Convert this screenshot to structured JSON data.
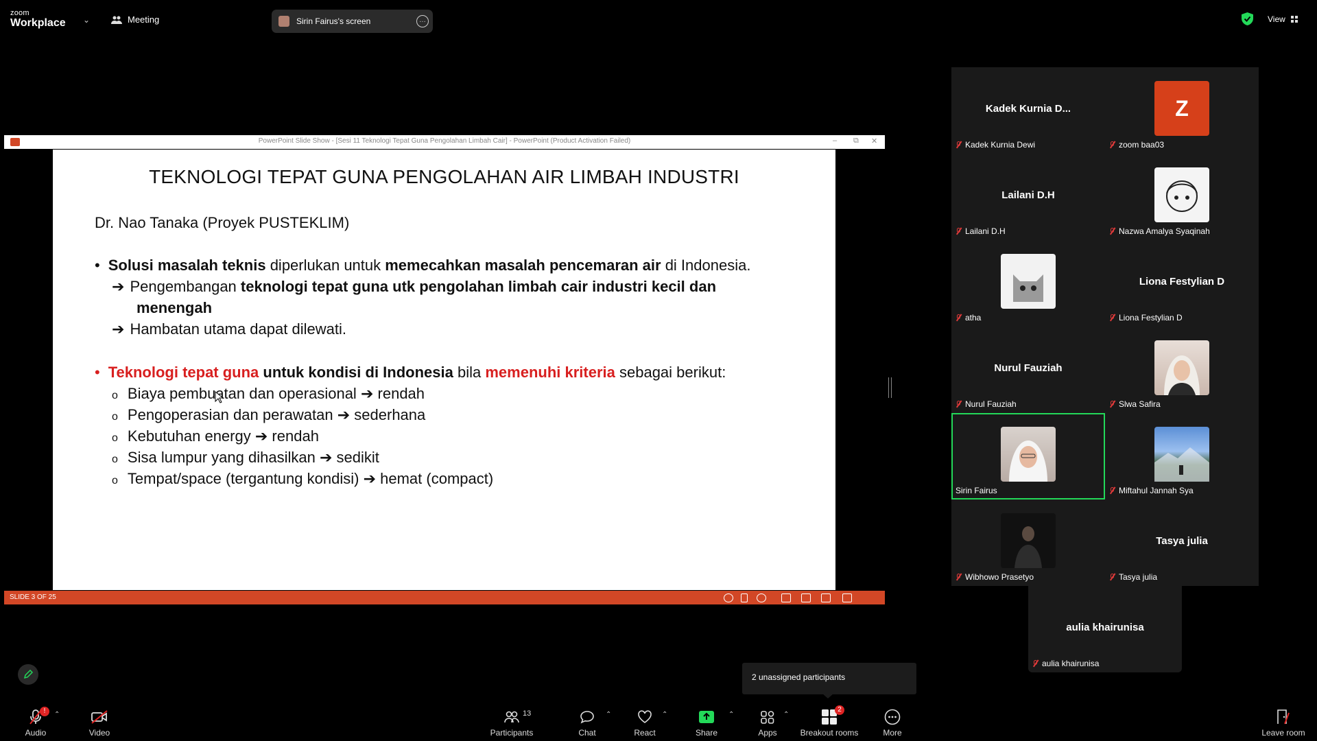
{
  "app": {
    "logo_top": "zoom",
    "logo_bottom": "Workplace",
    "meeting_label": "Meeting",
    "share_pill": "Sirin Fairus's screen",
    "view_label": "View"
  },
  "ppt": {
    "window_title": "PowerPoint Slide Show - [Sesi 11 Teknologi Tepat Guna Pengolahan Limbah Cair] - PowerPoint (Product Activation Failed)",
    "slide_title": "TEKNOLOGI TEPAT GUNA PENGOLAHAN AIR LIMBAH INDUSTRI",
    "author": "Dr. Nao Tanaka (Proyek PUSTEKLIM)",
    "b1": {
      "p1": "Solusi masalah teknis",
      "p2": " diperlukan untuk ",
      "p3": "memecahkan masalah pencemaran air",
      "p4": " di Indonesia."
    },
    "b1a": {
      "p1": "Pengembangan ",
      "p2": "teknologi tepat guna utk pengolahan limbah cair industri kecil dan",
      "p3": "menengah"
    },
    "b1b": "Hambatan utama dapat dilewati.",
    "b2": {
      "p1": "Teknologi tepat guna",
      "p2": " untuk kondisi di Indonesia",
      "p3": " bila ",
      "p4": "memenuhi kriteria",
      "p5": " sebagai berikut:"
    },
    "sub": [
      {
        "a": "Biaya pembuatan dan operasional",
        "b": "rendah"
      },
      {
        "a": "Pengoperasian dan perawatan",
        "b": "sederhana"
      },
      {
        "a": "Kebutuhan energy",
        "b": "rendah"
      },
      {
        "a": "Sisa lumpur yang dihasilkan",
        "b": "sedikit"
      },
      {
        "a": "Tempat/space (tergantung kondisi)",
        "b": "hemat (compact)"
      }
    ],
    "status": "SLIDE 3 OF 25"
  },
  "participants": [
    {
      "display": "Kadek Kurnia D...",
      "label": "Kadek Kurnia Dewi"
    },
    {
      "display": "Z",
      "label": "zoom baa03"
    },
    {
      "display": "Lailani D.H",
      "label": "Lailani D.H"
    },
    {
      "display": "",
      "label": "Nazwa Amalya Syaqinah"
    },
    {
      "display": "",
      "label": "atha"
    },
    {
      "display": "Liona Festylian D",
      "label": "Liona Festylian D"
    },
    {
      "display": "Nurul Fauziah",
      "label": "Nurul Fauziah"
    },
    {
      "display": "",
      "label": "Slwa Safira"
    },
    {
      "display": "",
      "label": "Sirin Fairus"
    },
    {
      "display": "",
      "label": "Miftahul Jannah Sya"
    },
    {
      "display": "",
      "label": "Wibhowo Prasetyo"
    },
    {
      "display": "Tasya julia",
      "label": "Tasya julia"
    },
    {
      "display": "aulia khairunisa",
      "label": "aulia khairunisa"
    }
  ],
  "tooltip": "2 unassigned participants",
  "toolbar": {
    "audio": "Audio",
    "video": "Video",
    "participants": "Participants",
    "participants_count": "13",
    "chat": "Chat",
    "react": "React",
    "share": "Share",
    "apps": "Apps",
    "breakout": "Breakout rooms",
    "breakout_badge": "2",
    "more": "More",
    "leave": "Leave room"
  },
  "colors": {
    "accent_green": "#23d959",
    "ppt_orange": "#d24726",
    "mute_red": "#e03a3a",
    "highlight_red": "#d81f1f"
  }
}
